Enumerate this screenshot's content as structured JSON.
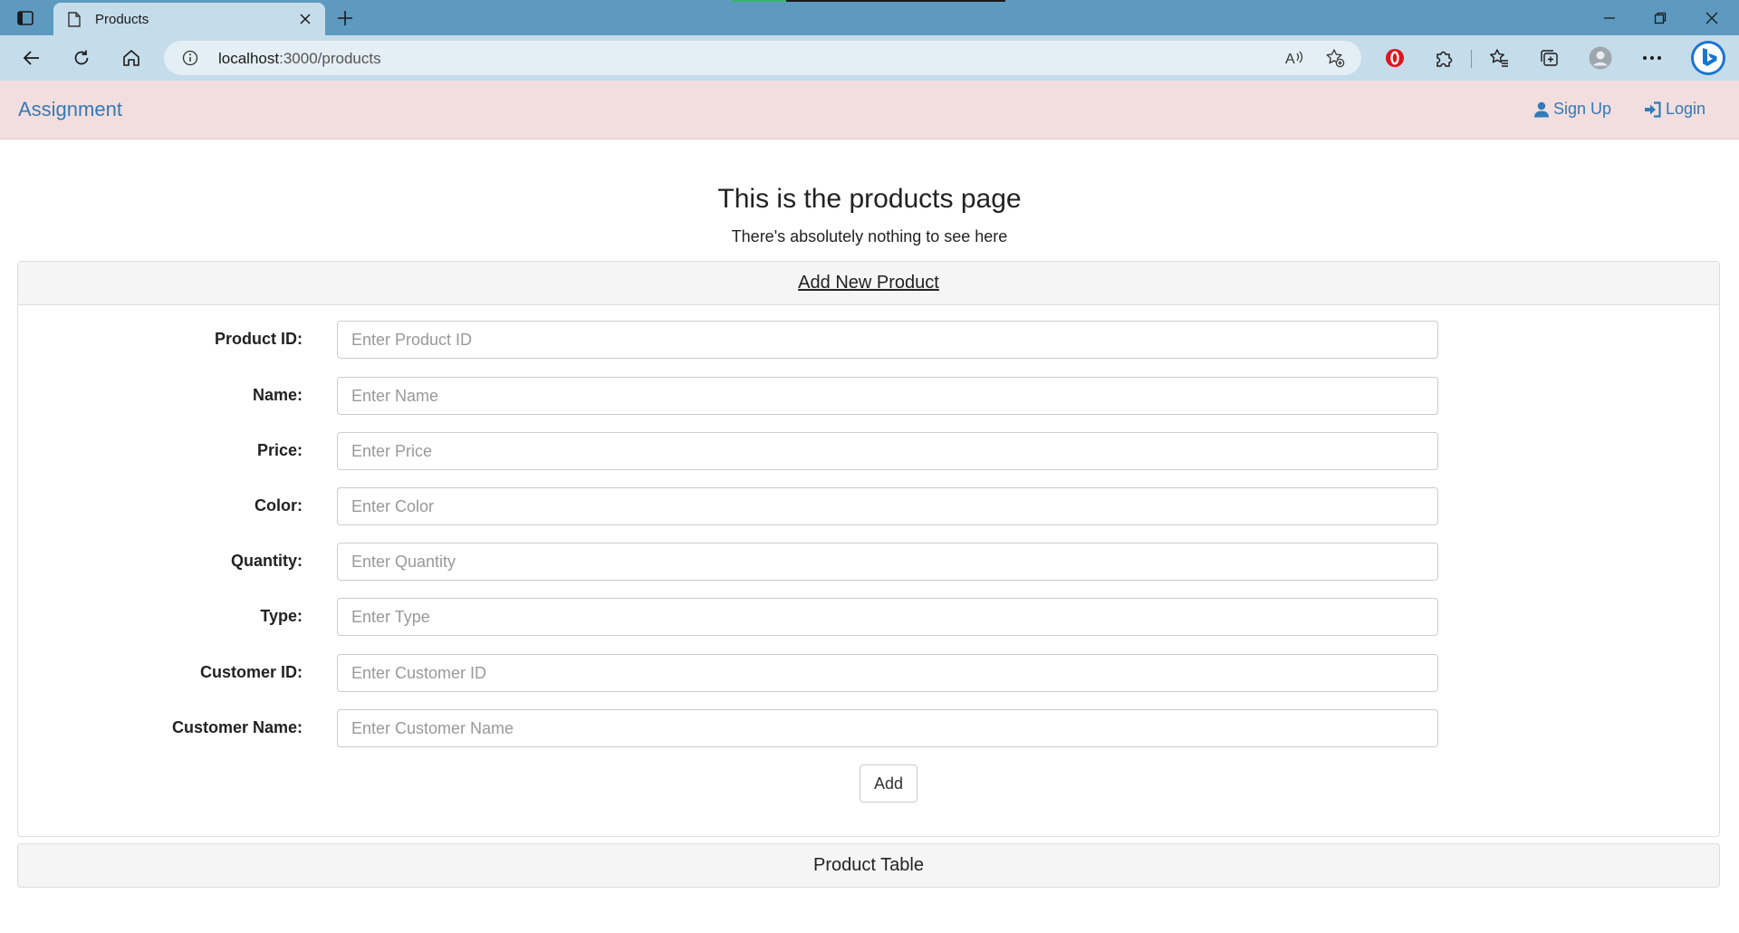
{
  "browser": {
    "tab_title": "Products",
    "url_host": "localhost",
    "url_path": ":3000/products",
    "icons": [
      "tab-actions-icon",
      "page-icon",
      "close-icon",
      "plus-icon",
      "minimize-icon",
      "restore-icon",
      "window-close-icon",
      "back-icon",
      "refresh-icon",
      "home-icon",
      "info-icon",
      "read-aloud-icon",
      "add-favorite-icon",
      "opera-icon",
      "extensions-icon",
      "favorites-icon",
      "collections-icon",
      "profile-icon",
      "more-icon",
      "bing-icon"
    ]
  },
  "navbar": {
    "brand": "Assignment",
    "signup_label": "Sign Up",
    "login_label": "Login",
    "background": "#f2dede",
    "link_color": "#337ab7"
  },
  "page": {
    "title": "This is the products page",
    "subtitle": "There's absolutely nothing to see here"
  },
  "form_panel": {
    "heading": "Add New Product",
    "fields": [
      {
        "label": "Product ID:",
        "placeholder": "Enter Product ID",
        "value": ""
      },
      {
        "label": "Name:",
        "placeholder": "Enter Name",
        "value": ""
      },
      {
        "label": "Price:",
        "placeholder": "Enter Price",
        "value": ""
      },
      {
        "label": "Color:",
        "placeholder": "Enter Color",
        "value": ""
      },
      {
        "label": "Quantity:",
        "placeholder": "Enter Quantity",
        "value": ""
      },
      {
        "label": "Type:",
        "placeholder": "Enter Type",
        "value": ""
      },
      {
        "label": "Customer ID:",
        "placeholder": "Enter Customer ID",
        "value": ""
      },
      {
        "label": "Customer Name:",
        "placeholder": "Enter Customer Name",
        "value": ""
      }
    ],
    "add_button": "Add"
  },
  "table_panel": {
    "heading": "Product Table"
  }
}
